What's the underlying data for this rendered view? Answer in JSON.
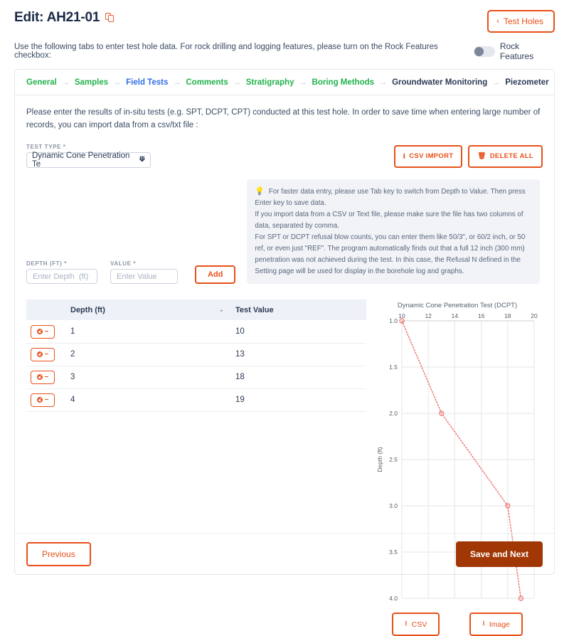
{
  "header": {
    "title": "Edit: AH21-01",
    "copy_icon": "copy-icon",
    "test_holes_button": "Test Holes",
    "test_holes_chevron": "‹",
    "instruction": "Use the following tabs to enter test hole data. For rock drilling and logging features, please turn on the Rock Features checkbox:",
    "rock_features_label": "Rock Features",
    "rock_features_on": false
  },
  "tabs": [
    {
      "label": "General",
      "state": "green"
    },
    {
      "label": "Samples",
      "state": "green"
    },
    {
      "label": "Field Tests",
      "state": "blue"
    },
    {
      "label": "Comments",
      "state": "green"
    },
    {
      "label": "Stratigraphy",
      "state": "green"
    },
    {
      "label": "Boring Methods",
      "state": "green"
    },
    {
      "label": "Groundwater Monitoring",
      "state": "dark"
    },
    {
      "label": "Piezometer",
      "state": "dark"
    }
  ],
  "tab_separator": "→",
  "main": {
    "intro": "Please enter the results of in-situ tests (e.g. SPT, DCPT, CPT) conducted at this test hole. In order to save time when entering large number of records, you can import data from a csv/txt file :",
    "test_type_label": "TEST TYPE *",
    "test_type_value": "Dynamic Cone Penetration Te",
    "csv_import_label": "CSV IMPORT",
    "csv_import_icon": "⭳",
    "delete_all_label": "DELETE ALL",
    "delete_all_icon": "🗑",
    "depth_label": "DEPTH (FT) *",
    "depth_placeholder": "Enter Depth  (ft)",
    "depth_value": "",
    "value_label": "VALUE *",
    "value_placeholder": "Enter Value",
    "value_value": "",
    "add_label": "Add"
  },
  "tip": {
    "bulb_icon": "💡",
    "lines": [
      "For faster data entry, please use Tab key to switch from Depth to Value. Then press Enter key to save data.",
      "If you import data from a CSV or Text file, please make sure the file has two columns of data, separated by comma.",
      "For SPT or DCPT refusal blow counts, you can enter them like 50/3\", or 60/2 inch, or 50 ref, or even just \"REF\". The program automatically finds out that a full 12 inch (300 mm) penetration was not achieved during the test. In this case, the Refusal N defined in the Setting page will be used for display in the borehole log and graphs."
    ]
  },
  "table": {
    "columns": [
      "",
      "Depth (ft)",
      "Test Value"
    ],
    "sort_caret": "⌄",
    "row_action_icons": [
      "gear-icon",
      "minus-icon"
    ],
    "rows": [
      {
        "depth": "1",
        "value": "10"
      },
      {
        "depth": "2",
        "value": "13"
      },
      {
        "depth": "3",
        "value": "18"
      },
      {
        "depth": "4",
        "value": "19"
      }
    ]
  },
  "chart_data": {
    "type": "line",
    "title": "Dynamic Cone Penetration Test (DCPT)",
    "xlabel": "",
    "ylabel": "Depth (ft)",
    "x_axis_position": "top",
    "y_axis_inverted": true,
    "xlim": [
      10,
      20
    ],
    "ylim": [
      1.0,
      4.0
    ],
    "xticks": [
      10,
      12,
      14,
      16,
      18,
      20
    ],
    "yticks": [
      1.0,
      1.5,
      2.0,
      2.5,
      3.0,
      3.5,
      4.0
    ],
    "ytick_labels": [
      "1.0",
      "1.5",
      "2.0",
      "2.5",
      "3.0",
      "3.5",
      "4.0"
    ],
    "grid": true,
    "legend": false,
    "line_style": "dotted",
    "color": "#ef8080",
    "marker": "circle-open",
    "x": [
      10,
      13,
      18,
      19
    ],
    "y": [
      1.0,
      2.0,
      3.0,
      4.0
    ],
    "series": [
      {
        "name": "DCPT",
        "values": [
          10,
          13,
          18,
          19
        ]
      }
    ]
  },
  "chart_buttons": {
    "csv_label": "CSV",
    "image_label": "Image",
    "download_icon": "⭳"
  },
  "footer": {
    "previous_label": "Previous",
    "save_next_label": "Save and Next"
  },
  "colors": {
    "accent": "#e8501a",
    "save_button": "#a03705",
    "tab_active": "#2f6fe4",
    "tab_done": "#21b24b",
    "chart_line": "#ef8080"
  }
}
